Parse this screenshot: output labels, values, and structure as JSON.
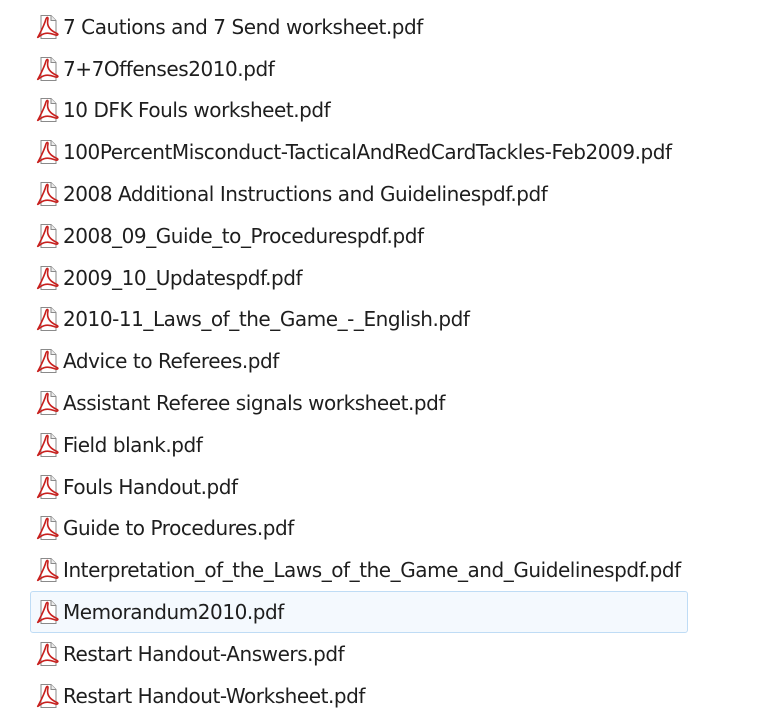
{
  "files": [
    {
      "name": "7 Cautions and 7 Send worksheet.pdf",
      "icon": "pdf-file-icon",
      "selected": false
    },
    {
      "name": "7+7Offenses2010.pdf",
      "icon": "pdf-file-icon",
      "selected": false
    },
    {
      "name": "10 DFK Fouls worksheet.pdf",
      "icon": "pdf-file-icon",
      "selected": false
    },
    {
      "name": "100PercentMisconduct-TacticalAndRedCardTackles-Feb2009.pdf",
      "icon": "pdf-file-icon",
      "selected": false
    },
    {
      "name": "2008 Additional Instructions and Guidelinespdf.pdf",
      "icon": "pdf-file-icon",
      "selected": false
    },
    {
      "name": "2008_09_Guide_to_Procedurespdf.pdf",
      "icon": "pdf-file-icon",
      "selected": false
    },
    {
      "name": "2009_10_Updatespdf.pdf",
      "icon": "pdf-file-icon",
      "selected": false
    },
    {
      "name": "2010-11_Laws_of_the_Game_-_English.pdf",
      "icon": "pdf-file-icon",
      "selected": false
    },
    {
      "name": "Advice to Referees.pdf",
      "icon": "pdf-file-icon",
      "selected": false
    },
    {
      "name": "Assistant Referee signals worksheet.pdf",
      "icon": "pdf-file-icon",
      "selected": false
    },
    {
      "name": "Field blank.pdf",
      "icon": "pdf-file-icon",
      "selected": false
    },
    {
      "name": "Fouls Handout.pdf",
      "icon": "pdf-file-icon",
      "selected": false
    },
    {
      "name": "Guide to Procedures.pdf",
      "icon": "pdf-file-icon",
      "selected": false
    },
    {
      "name": "Interpretation_of_the_Laws_of_the_Game_and_Guidelinespdf.pdf",
      "icon": "pdf-file-icon",
      "selected": false
    },
    {
      "name": "Memorandum2010.pdf",
      "icon": "pdf-file-icon",
      "selected": true
    },
    {
      "name": "Restart Handout-Answers.pdf",
      "icon": "pdf-file-icon",
      "selected": false
    },
    {
      "name": "Restart Handout-Worksheet.pdf",
      "icon": "pdf-file-icon",
      "selected": false
    }
  ],
  "colors": {
    "pdf_red": "#c8201e",
    "selection_bg": "#f4f9fe",
    "selection_border": "#bfdcf5",
    "text": "#1e1e1e"
  }
}
